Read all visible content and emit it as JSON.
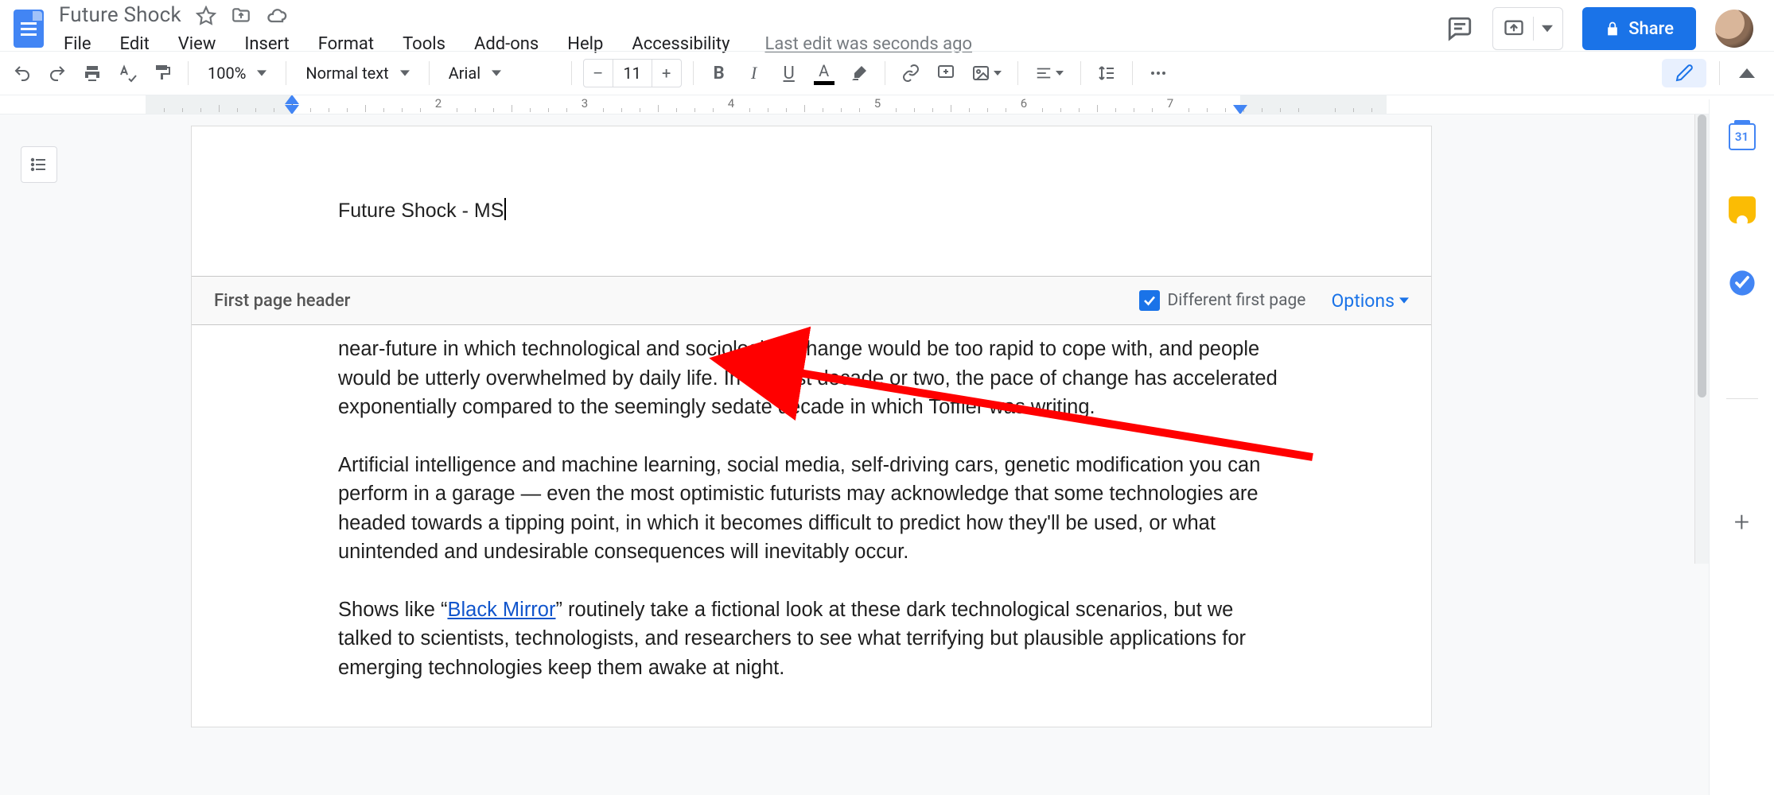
{
  "document": {
    "title": "Future Shock",
    "header_text": "Future Shock - MS",
    "body_paragraphs": [
      "near-future in which technological and sociological change would be too rapid to cope with, and people would be utterly overwhelmed by daily life. In the last decade or two, the pace of change has accelerated exponentially compared to the seemingly sedate decade in which Toffler was writing.",
      "Artificial intelligence and machine learning, social media, self-driving cars, genetic modification you can perform in a garage — even the most optimistic futurists may acknowledge that some technologies are headed towards a tipping point, in which it becomes difficult to predict how they'll be used, or what unintended and undesirable consequences will inevitably occur."
    ],
    "body_para3_pre": "Shows like “",
    "body_para3_link": "Black Mirror",
    "body_para3_post": "” routinely take a fictional look at these dark technological scenarios, but we talked to scientists, technologists, and researchers to see what terrifying but plausible applications for emerging technologies keep them awake at night."
  },
  "menu": {
    "file": "File",
    "edit": "Edit",
    "view": "View",
    "insert": "Insert",
    "format": "Format",
    "tools": "Tools",
    "addons": "Add-ons",
    "help": "Help",
    "accessibility": "Accessibility",
    "last_edit": "Last edit was seconds ago"
  },
  "toolbar": {
    "zoom": "100%",
    "style": "Normal text",
    "font": "Arial",
    "font_size": "11",
    "minus": "–",
    "plus": "+"
  },
  "header_bar": {
    "label": "First page header",
    "different_first": "Different first page",
    "options": "Options"
  },
  "share": {
    "label": "Share"
  },
  "side": {
    "cal_day": "31"
  }
}
